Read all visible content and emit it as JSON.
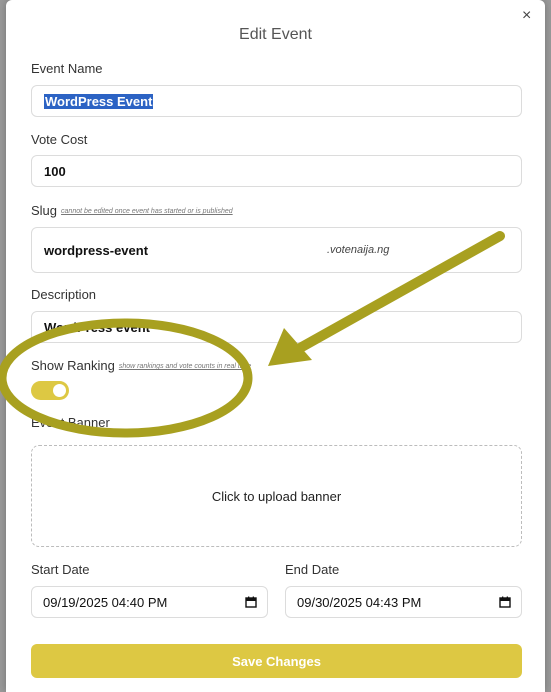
{
  "modal": {
    "title": "Edit Event",
    "close": "×"
  },
  "form": {
    "event_name": {
      "label": "Event Name",
      "value": "WordPress Event"
    },
    "vote_cost": {
      "label": "Vote Cost",
      "value": "100"
    },
    "slug": {
      "label": "Slug",
      "hint": "cannot be edited once event has started or is published",
      "value": "wordpress-event",
      "suffix": ".votenaija.ng"
    },
    "description": {
      "label": "Description",
      "value": "WordPress event"
    },
    "show_ranking": {
      "label": "Show Ranking",
      "hint": "show rankings and vote counts in real time",
      "enabled": true
    },
    "event_banner": {
      "label": "Event Banner",
      "upload_text": "Click to upload banner"
    },
    "start_date": {
      "label": "Start Date",
      "value": "09/19/2025 04:40 PM"
    },
    "end_date": {
      "label": "End Date",
      "value": "09/30/2025 04:43 PM"
    },
    "save_label": "Save Changes"
  },
  "colors": {
    "accent": "#ddc843",
    "annotation": "#a8a020",
    "selection": "#2c63c4"
  }
}
